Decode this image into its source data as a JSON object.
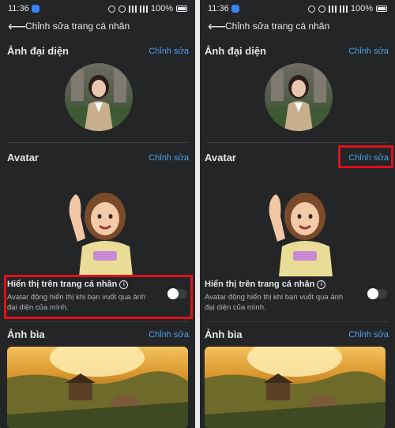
{
  "status_bar": {
    "time": "11:36",
    "battery": "100%"
  },
  "header": {
    "title": "Chỉnh sửa trang cá nhân"
  },
  "profile_photo": {
    "title": "Ảnh đại diện",
    "edit": "Chỉnh sửa"
  },
  "avatar": {
    "title": "Avatar",
    "edit": "Chỉnh sửa"
  },
  "show_on_profile": {
    "title": "Hiển thị trên trang cá nhân",
    "description": "Avatar động hiển thị khi bạn vuốt qua ảnh đại diện của mình.",
    "enabled": false
  },
  "cover_photo": {
    "title": "Ảnh bìa",
    "edit": "Chỉnh sửa"
  },
  "highlight_color": "#e0101c",
  "accent_color": "#4aa3f0"
}
